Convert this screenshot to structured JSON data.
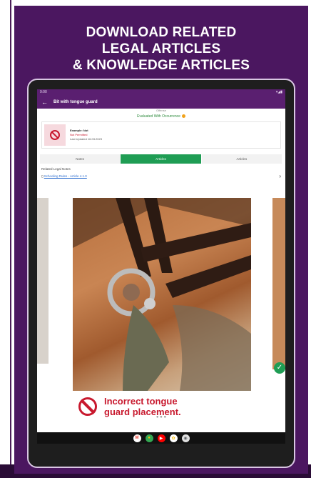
{
  "headline": {
    "line1": "DOWNLOAD RELATED",
    "line2": "LEGAL ARTICLES",
    "line3": "& KNOWLEDGE ARTICLES"
  },
  "status_bar": {
    "time": "9:00",
    "icons": "▾◢▮"
  },
  "app_bar": {
    "title": "Bit with tongue guard"
  },
  "screen": {
    "top_line": "Offense",
    "verified_text": "Evaluated With Occurrence",
    "info_card": {
      "title": "Example: Not",
      "subtitle": "Not Permitted",
      "date_line": "Last Updated 16.03.2023"
    },
    "tabs": [
      {
        "label": "Notes"
      },
      {
        "label": "Articles"
      },
      {
        "label": "Articles"
      }
    ],
    "legal_heading": "Related Legal Notes",
    "legal_link": "Schooling Rules - Article 4.1.0",
    "caption_line1": "Incorrect tongue",
    "caption_line2": "guard placement.",
    "pager_dots": "● ● ●",
    "ok_mark": "✓"
  },
  "nav_icons": [
    {
      "name": "gmail",
      "glyph": "M",
      "color": "#ea4335"
    },
    {
      "name": "chrome",
      "glyph": "●",
      "color": "#34a853"
    },
    {
      "name": "youtube",
      "glyph": "▶",
      "color": "#ff0000"
    },
    {
      "name": "photos",
      "glyph": "✿",
      "color": "#fbbc05"
    },
    {
      "name": "camera",
      "glyph": "◉",
      "color": "#5f6368"
    }
  ],
  "colors": {
    "panel": "#4b1760",
    "accent_green": "#1f9d54",
    "warning_red": "#c8192e"
  }
}
